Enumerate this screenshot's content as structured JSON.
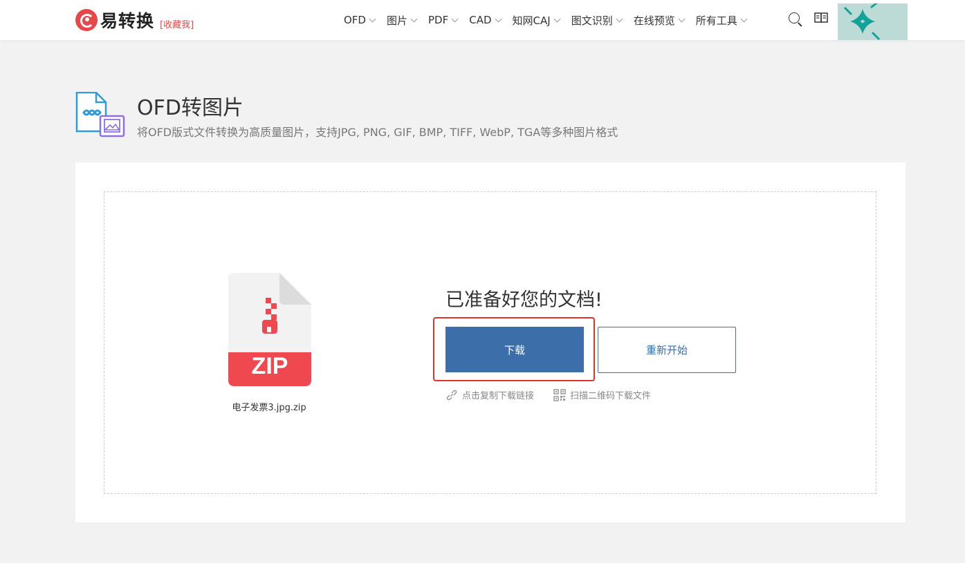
{
  "header": {
    "logo_text": "易转换",
    "favorite_label": "[收藏我]",
    "nav": [
      {
        "label": "OFD"
      },
      {
        "label": "图片"
      },
      {
        "label": "PDF"
      },
      {
        "label": "CAD"
      },
      {
        "label": "知网CAJ"
      },
      {
        "label": "图文识别"
      },
      {
        "label": "在线预览"
      },
      {
        "label": "所有工具"
      }
    ],
    "icons": [
      "search-icon",
      "book-icon"
    ]
  },
  "page": {
    "title": "OFD转图片",
    "subtitle": "将OFD版式文件转换为高质量图片，支持JPG, PNG, GIF, BMP, TIFF, WebP, TGA等多种图片格式"
  },
  "result": {
    "file_badge": "ZIP",
    "file_name": "电子发票3.jpg.zip",
    "ready_text": "已准备好您的文档!",
    "download_label": "下载",
    "restart_label": "重新开始",
    "copy_link_label": "点击复制下载链接",
    "scan_qr_label": "扫描二维码下载文件"
  },
  "colors": {
    "brand_red": "#e8474a",
    "primary_blue": "#3c6fa9",
    "highlight_red": "#e0322d",
    "zip_red": "#f0484f"
  }
}
